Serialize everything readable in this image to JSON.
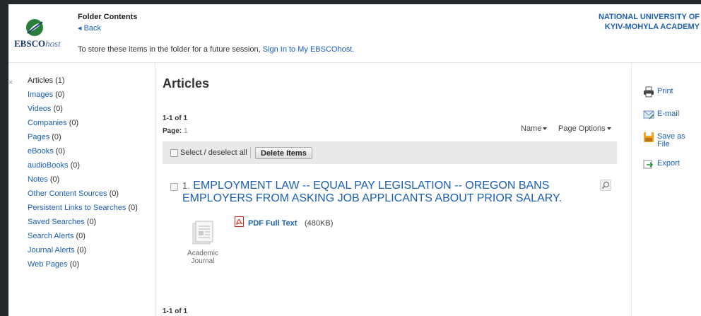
{
  "header": {
    "logo_text": "EBSCO",
    "logo_text_italic": "host",
    "title": "Folder Contents",
    "back_label": "◂ Back",
    "store_text": "To store these items in the folder for a future session,",
    "sign_in_link": "Sign In to My EBSCOhost.",
    "university_line1": "NATIONAL UNIVERSITY OF",
    "university_line2": "KYIV-MOHYLA ACADEMY"
  },
  "sidebar": {
    "collapse_icon": "×",
    "items": [
      {
        "label": "Articles",
        "count": "(1)"
      },
      {
        "label": "Images",
        "count": "(0)"
      },
      {
        "label": "Videos",
        "count": "(0)"
      },
      {
        "label": "Companies",
        "count": "(0)"
      },
      {
        "label": "Pages",
        "count": "(0)"
      },
      {
        "label": "eBooks",
        "count": "(0)"
      },
      {
        "label": "audioBooks",
        "count": "(0)"
      },
      {
        "label": "Notes",
        "count": "(0)"
      },
      {
        "label": "Other Content Sources",
        "count": "(0)"
      },
      {
        "label": "Persistent Links to Searches",
        "count": "(0)"
      },
      {
        "label": "Saved Searches",
        "count": "(0)"
      },
      {
        "label": "Search Alerts",
        "count": "(0)"
      },
      {
        "label": "Journal Alerts",
        "count": "(0)"
      },
      {
        "label": "Web Pages",
        "count": "(0)"
      }
    ]
  },
  "main": {
    "title": "Articles",
    "range_top": "1-1 of 1",
    "page_label": "Page:",
    "page_number": "1",
    "sort_label": "Name",
    "page_options_label": "Page Options",
    "select_all_label": "Select / deselect all",
    "delete_label": "Delete Items",
    "range_bottom": "1-1 of 1"
  },
  "results": [
    {
      "index": "1.",
      "title": "EMPLOYMENT LAW -- EQUAL PAY LEGISLATION -- OREGON BANS EMPLOYERS FROM ASKING JOB APPLICANTS ABOUT PRIOR SALARY.",
      "doc_type": "Academic Journal",
      "fulltext_label": "PDF Full Text",
      "fulltext_size": "(480KB)"
    }
  ],
  "actions": {
    "print": "Print",
    "email": "E-mail",
    "save": "Save as File",
    "export": "Export"
  },
  "colors": {
    "link": "#1a5fb4",
    "frame_bg": "#23282d",
    "toolbar_bg": "#e9e9e9"
  }
}
